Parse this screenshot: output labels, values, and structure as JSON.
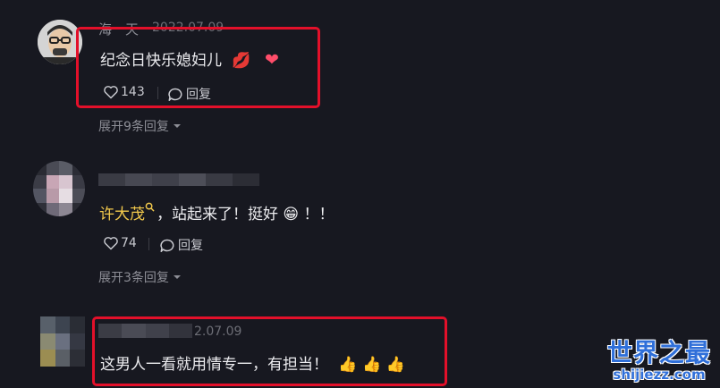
{
  "comments": [
    {
      "username": "海一天",
      "date": "2022.07.09",
      "text": "纪念日快乐媳妇儿",
      "emoji_lips": "💋",
      "emoji_heart": "❤",
      "likes": "143",
      "reply_label": "回复",
      "expand_label": "展开9条回复"
    },
    {
      "mention": "许大茂",
      "text": "，站起来了！挺好",
      "emoji_grin": "😁",
      "suffix": "！！",
      "likes": "74",
      "reply_label": "回复",
      "expand_label": "展开3条回复"
    },
    {
      "date": "2.07.09",
      "text": "这男人一看就用情专一，有担当！",
      "emoji_thumbs": "👍 👍 👍"
    }
  ],
  "watermark": {
    "title": "世界之最",
    "domain": "shijiezz.com"
  },
  "colors": {
    "background": "#171820",
    "highlight_box": "#e3102a",
    "mention": "#f2c94c",
    "watermark_blue": "#2f6fd9"
  }
}
